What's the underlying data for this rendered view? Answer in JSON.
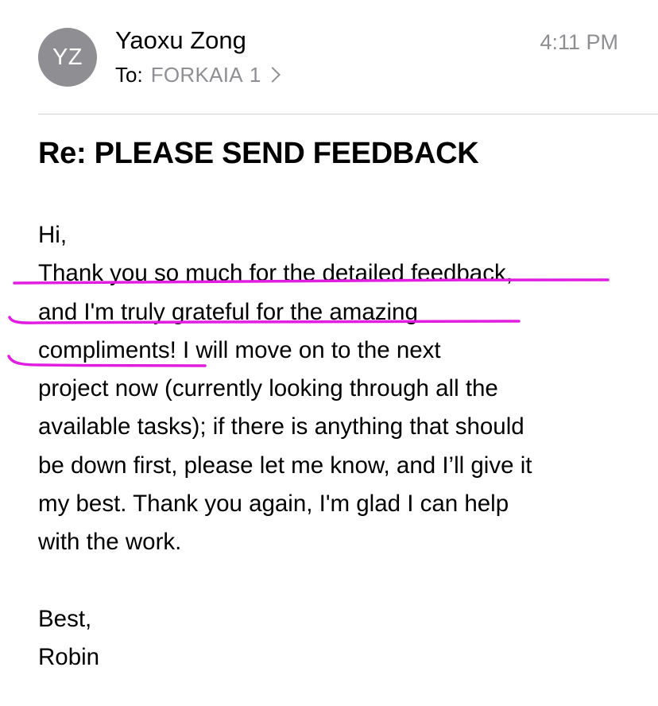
{
  "header": {
    "avatar_initials": "YZ",
    "sender_name": "Yaoxu Zong",
    "time": "4:11 PM",
    "to_label": "To:",
    "to_recipient": "FORKAIA",
    "to_count": "1",
    "chevron_icon": "chevron-right-icon"
  },
  "subject": "Re: PLEASE SEND FEEDBACK",
  "body": {
    "lines": [
      "Hi,",
      "Thank you so much for the detailed feedback,",
      "and I'm truly grateful for the amazing",
      "compliments! I will move on to the next",
      "project now (currently looking through all the",
      "available tasks); if there is anything that should",
      "be down first, please let me know, and I’ll give it",
      "my best. Thank you again, I'm glad I can help",
      "with the work."
    ],
    "closing": "Best,",
    "signature": "Robin"
  },
  "colors": {
    "avatar_bg": "#8e8e93",
    "secondary_text": "#8e8e93",
    "annotation": "#e01ee0"
  }
}
